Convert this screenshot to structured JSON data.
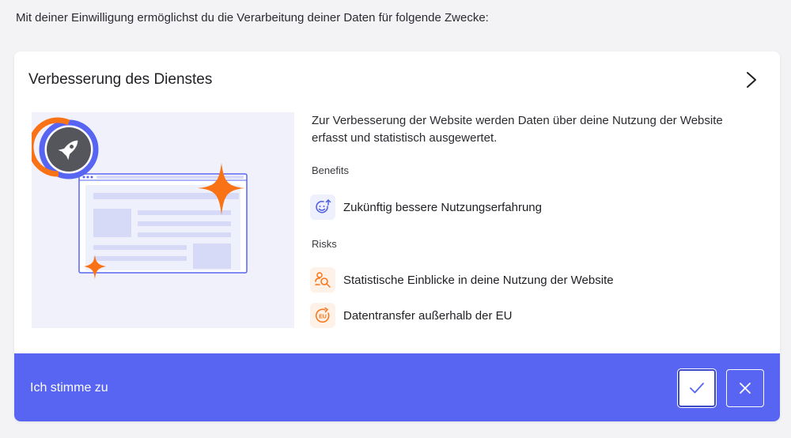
{
  "intro_text": "Mit deiner Einwilligung ermöglichst du die Verarbeitung deiner Daten für folgende Zwecke:",
  "purpose": {
    "title": "Verbesserung des Dienstes",
    "description": "Zur Verbesserung der Website werden Daten über deine Nutzung der Website erfasst und statistisch ausgewertet.",
    "benefits_label": "Benefits",
    "benefits": [
      {
        "icon": "smiley-arrow-icon",
        "text": "Zukünftig bessere Nutzungserfahrung"
      }
    ],
    "risks_label": "Risks",
    "risks": [
      {
        "icon": "person-search-icon",
        "text": "Statistische Einblicke in deine Nutzung der Website"
      },
      {
        "icon": "eu-transfer-icon",
        "text": "Datentransfer außerhalb der EU"
      }
    ]
  },
  "footer": {
    "label": "Ich stimme zu",
    "accept_icon": "checkmark-icon",
    "decline_icon": "close-icon"
  },
  "colors": {
    "accent": "#5865f2",
    "orange": "#f97316",
    "icon_blue": "#4f5de0"
  }
}
